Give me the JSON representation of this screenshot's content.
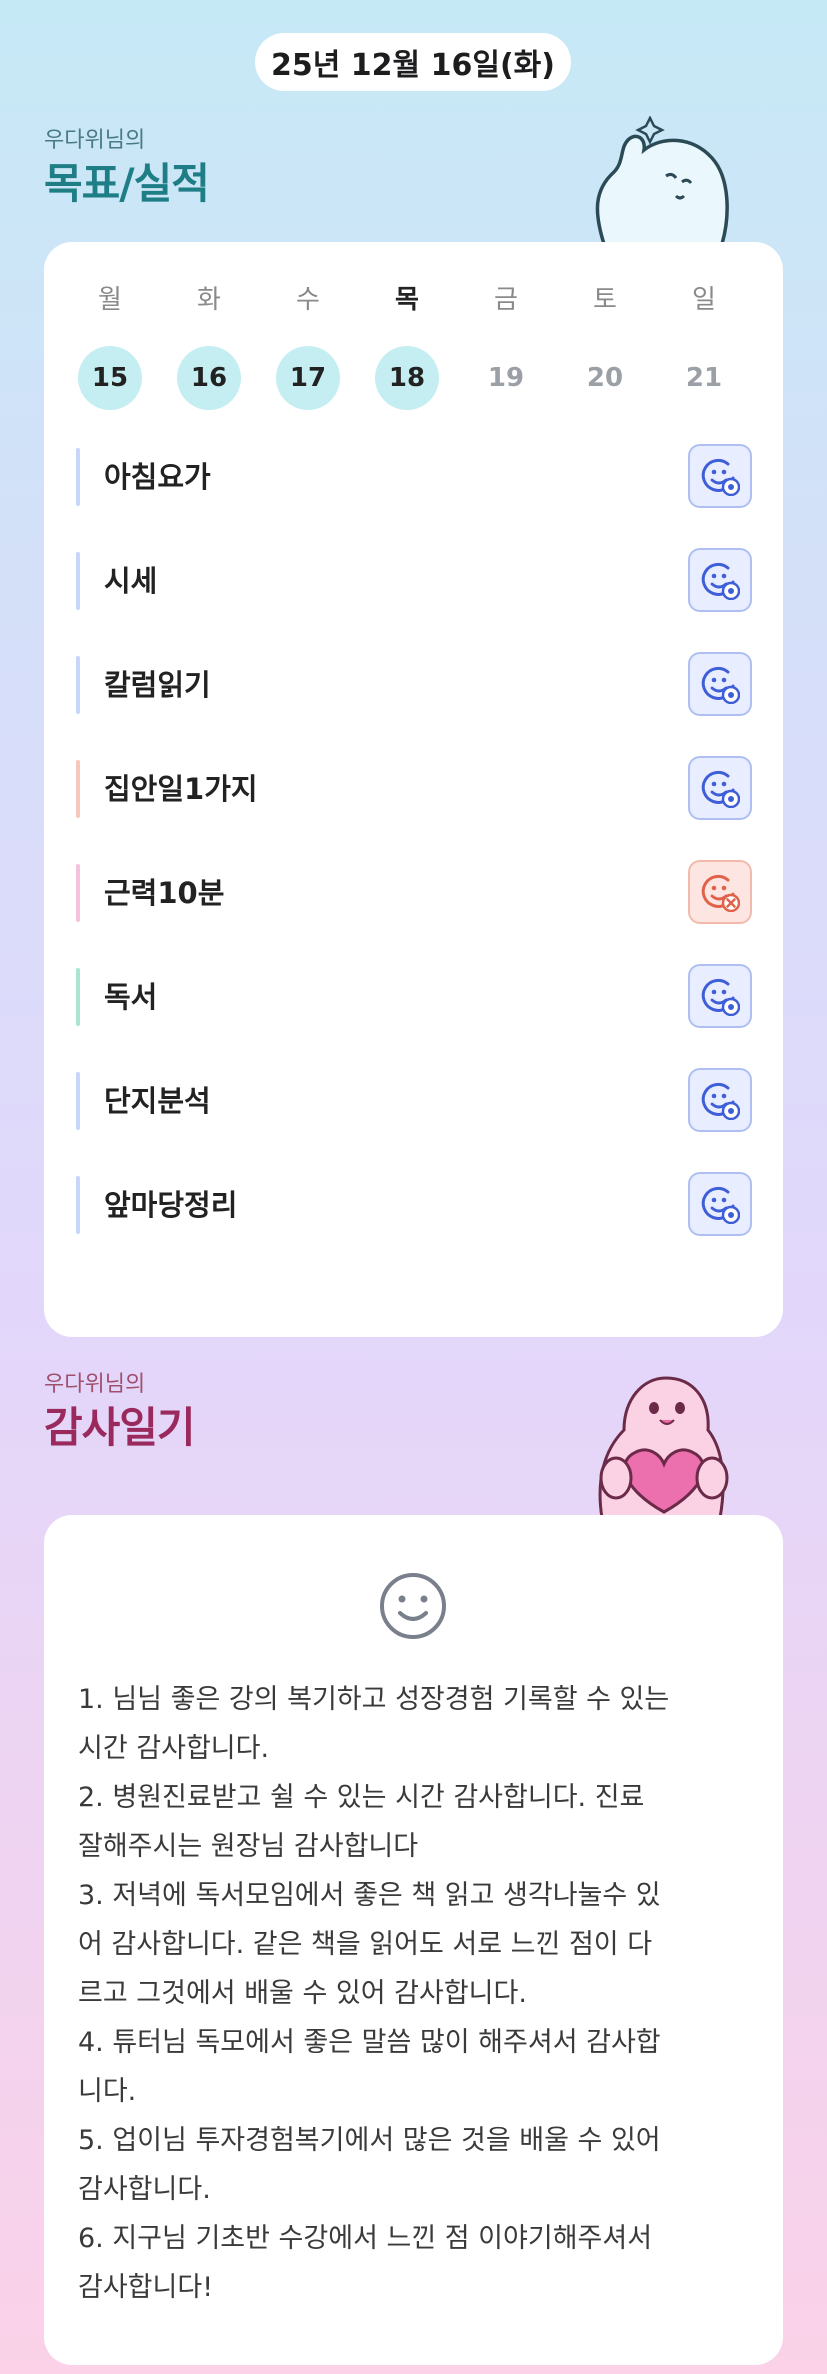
{
  "date": "25년 12월 16일(화)",
  "goals_section": {
    "subtitle": "우다위님의",
    "title": "목표/실적"
  },
  "week": {
    "days": [
      {
        "name": "월",
        "num": "15",
        "done": true,
        "today": false
      },
      {
        "name": "화",
        "num": "16",
        "done": true,
        "today": false
      },
      {
        "name": "수",
        "num": "17",
        "done": true,
        "today": false
      },
      {
        "name": "목",
        "num": "18",
        "done": true,
        "today": true
      },
      {
        "name": "금",
        "num": "19",
        "done": false,
        "today": false
      },
      {
        "name": "토",
        "num": "20",
        "done": false,
        "today": false
      },
      {
        "name": "일",
        "num": "21",
        "done": false,
        "today": false
      }
    ]
  },
  "goals": [
    {
      "label": "아침요가",
      "bar_color": "#c9d6fb",
      "status": "success-icon"
    },
    {
      "label": "시세",
      "bar_color": "#c9d6fb",
      "status": "success-icon"
    },
    {
      "label": "칼럼읽기",
      "bar_color": "#c9d6fb",
      "status": "success-icon"
    },
    {
      "label": "집안일1가지",
      "bar_color": "#f7c7bd",
      "status": "success-icon"
    },
    {
      "label": "근력10분",
      "bar_color": "#f5c2de",
      "status": "fail-icon"
    },
    {
      "label": "독서",
      "bar_color": "#a8e6cf",
      "status": "success-icon"
    },
    {
      "label": "단지분석",
      "bar_color": "#c9d6fb",
      "status": "success-icon"
    },
    {
      "label": "앞마당정리",
      "bar_color": "#c9d6fb",
      "status": "success-icon"
    }
  ],
  "diary_section": {
    "subtitle": "우다위님의",
    "title": "감사일기"
  },
  "diary_text": "1. 님님 좋은 강의 복기하고 성장경험 기록할 수 있는\n시간 감사합니다.\n2. 병원진료받고 쉴 수 있는 시간 감사합니다. 진료\n잘해주시는 원장님 감사합니다\n3. 저녁에 독서모임에서 좋은 책 읽고 생각나눌수 있\n어 감사합니다. 같은 책을 읽어도 서로 느낀 점이 다\n르고 그것에서 배울 수 있어 감사합니다.\n4. 튜터님 독모에서 좋은 말씀 많이 해주셔서 감사합\n니다.\n5. 업이님 투자경험복기에서 많은 것을 배울 수 있어\n감사합니다.\n6. 지구님 기초반 수강에서 느낀 점 이야기해주셔서\n감사합니다!",
  "colors": {
    "accent_teal": "#1f7d86",
    "accent_plum": "#9a2a5e",
    "done_day": "#c4eef2",
    "success": "#3f5fd8",
    "fail": "#e0624a"
  }
}
